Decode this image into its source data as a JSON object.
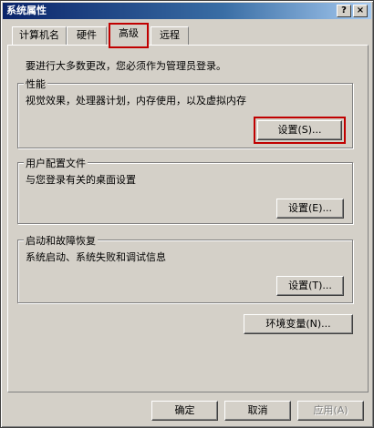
{
  "window": {
    "title": "系统属性",
    "help_symbol": "?",
    "close_symbol": "×"
  },
  "tabs": [
    {
      "label": "计算机名"
    },
    {
      "label": "硬件"
    },
    {
      "label": "高级"
    },
    {
      "label": "远程"
    }
  ],
  "notice": "要进行大多数更改，您必须作为管理员登录。",
  "groups": {
    "performance": {
      "title": "性能",
      "desc": "视觉效果，处理器计划，内存使用，以及虚拟内存",
      "button": "设置(S)..."
    },
    "profiles": {
      "title": "用户配置文件",
      "desc": "与您登录有关的桌面设置",
      "button": "设置(E)..."
    },
    "startup": {
      "title": "启动和故障恢复",
      "desc": "系统启动、系统失败和调试信息",
      "button": "设置(T)..."
    }
  },
  "env_button": "环境变量(N)...",
  "footer": {
    "ok": "确定",
    "cancel": "取消",
    "apply": "应用(A)"
  },
  "colors": {
    "highlight": "#c00000",
    "face": "#d4d0c8",
    "titlebar": "#0a246a"
  }
}
